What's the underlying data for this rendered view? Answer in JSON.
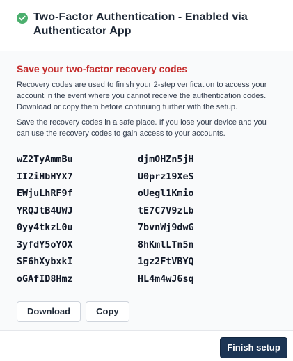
{
  "header": {
    "title": "Two-Factor Authentication - Enabled via Authenticator App",
    "status_icon": "check-circle-icon",
    "status_color": "#4caf6e"
  },
  "body": {
    "heading": "Save your two-factor recovery codes",
    "heading_color": "#c42b2b",
    "paragraph1": "Recovery codes are used to finish your 2-step verification to access your account in the event where you cannot receive the authentication codes. Download or copy them before continuing further with the setup.",
    "paragraph2": "Save the recovery codes in a safe place. If you lose your device and you can use the recovery codes to gain access to your accounts.",
    "codes": [
      [
        "wZ2TyAmmBu",
        "djmOHZn5jH"
      ],
      [
        "II2iHbHYX7",
        "U0prz19XeS"
      ],
      [
        "EWjuLhRF9f",
        "oUegl1Kmio"
      ],
      [
        "YRQJtB4UWJ",
        "tE7C7V9zLb"
      ],
      [
        "0yy4tkzL0u",
        "7bvnWj9dwG"
      ],
      [
        "3yfdY5oYOX",
        "8hKmlLTn5n"
      ],
      [
        "SF6hXybxkI",
        "1gz2FtVBYQ"
      ],
      [
        "oGAfID8Hmz",
        "HL4m4wJ6sq"
      ]
    ],
    "download_label": "Download",
    "copy_label": "Copy"
  },
  "footer": {
    "finish_label": "Finish setup",
    "finish_color": "#1c3554"
  }
}
